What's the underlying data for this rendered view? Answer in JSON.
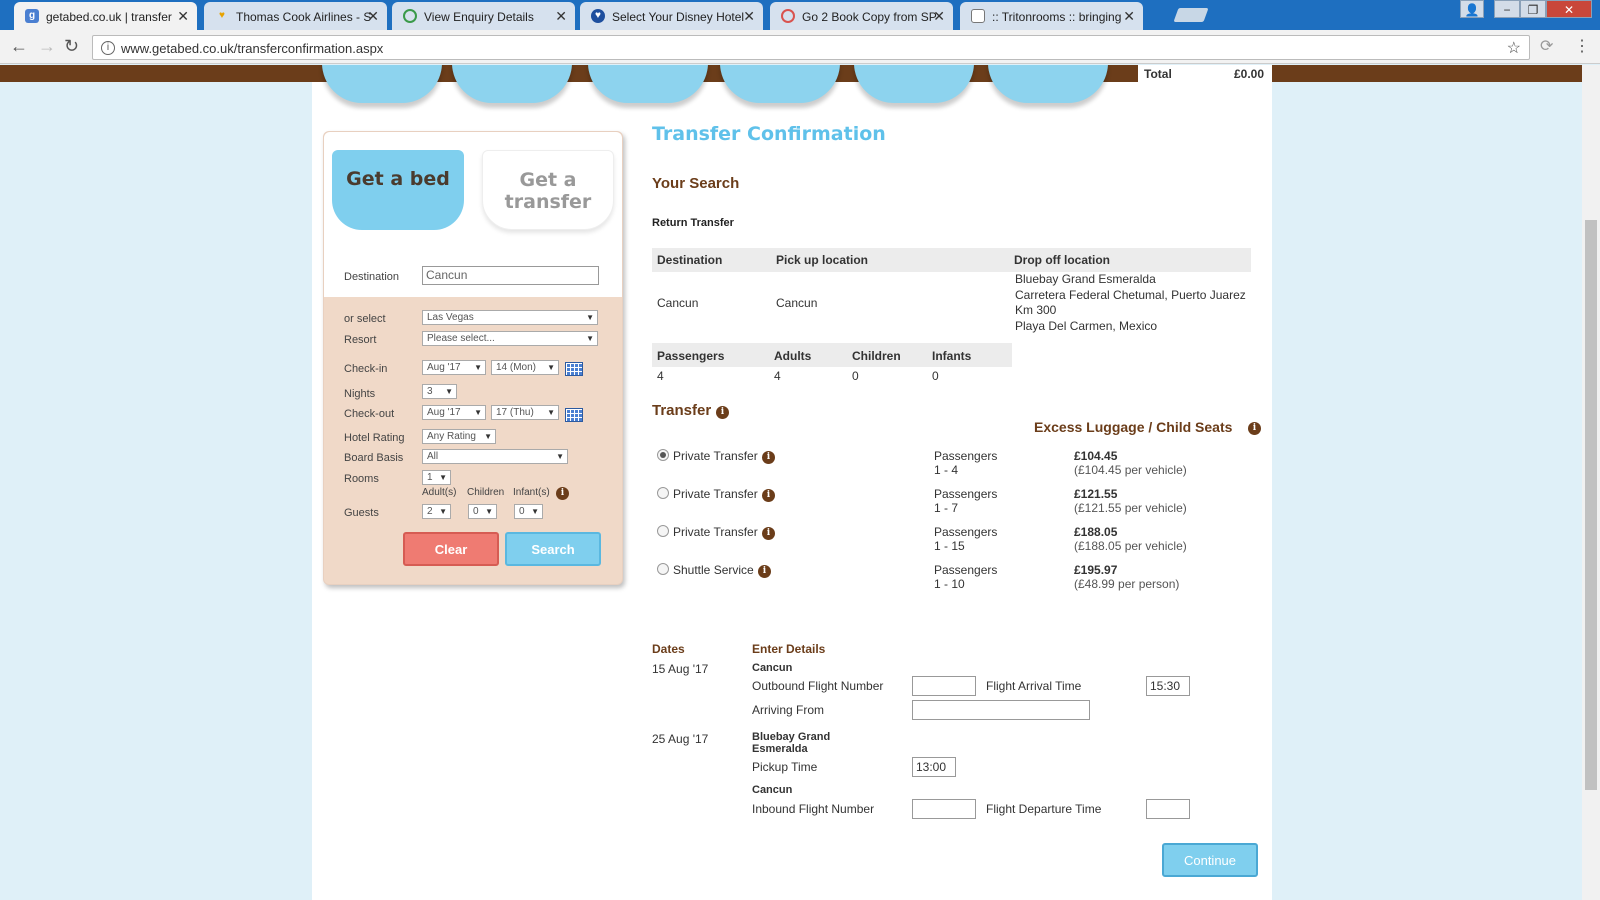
{
  "browser": {
    "tabs": [
      {
        "title": "getabed.co.uk | transfer",
        "favicon": "g"
      },
      {
        "title": "Thomas Cook Airlines - S",
        "favicon": "heart"
      },
      {
        "title": "View Enquiry Details",
        "favicon": "o"
      },
      {
        "title": "Select Your Disney Hotel",
        "favicon": "shield"
      },
      {
        "title": "Go 2 Book Copy from SP",
        "favicon": "o"
      },
      {
        "title": ":: Tritonrooms :: bringing",
        "favicon": "page"
      }
    ],
    "url": "www.getabed.co.uk/transferconfirmation.aspx"
  },
  "header": {
    "total_label": "Total",
    "total_value": "£0.00"
  },
  "search_box": {
    "tab_bed": "Get a bed",
    "tab_transfer": "Get a transfer",
    "destination_label": "Destination",
    "destination_value": "Cancun",
    "or_select_label": "or select",
    "or_select_value": "Las Vegas",
    "resort_label": "Resort",
    "resort_value": "Please select...",
    "checkin_label": "Check-in",
    "checkin_month": "Aug '17",
    "checkin_day": "14 (Mon)",
    "nights_label": "Nights",
    "nights_value": "3",
    "checkout_label": "Check-out",
    "checkout_month": "Aug '17",
    "checkout_day": "17 (Thu)",
    "hotel_rating_label": "Hotel Rating",
    "hotel_rating_value": "Any Rating",
    "board_basis_label": "Board Basis",
    "board_basis_value": "All",
    "rooms_label": "Rooms",
    "rooms_value": "1",
    "guests_label": "Guests",
    "adults_label": "Adult(s)",
    "children_label": "Children",
    "infants_label": "Infant(s)",
    "adults_value": "2",
    "children_value": "0",
    "infants_value": "0",
    "clear_label": "Clear",
    "search_label": "Search"
  },
  "main": {
    "title": "Transfer Confirmation",
    "your_search": "Your Search",
    "return_transfer": "Return Transfer",
    "table1_headers": [
      "Destination",
      "Pick up location",
      "Drop off location"
    ],
    "destination": "Cancun",
    "pickup": "Cancun",
    "dropoff_lines": [
      "Bluebay Grand Esmeralda",
      "Carretera Federal Chetumal, Puerto Juarez",
      "Km 300",
      "Playa Del Carmen, Mexico"
    ],
    "table2_headers": [
      "Passengers",
      "Adults",
      "Children",
      "Infants"
    ],
    "table2_values": [
      "4",
      "4",
      "0",
      "0"
    ],
    "transfer_heading": "Transfer",
    "excess_heading": "Excess Luggage / Child Seats",
    "options": [
      {
        "name": "Private Transfer",
        "pax_label": "Passengers",
        "pax_range": "1 - 4",
        "price": "£104.45",
        "unit": "(£104.45 per vehicle)",
        "selected": true
      },
      {
        "name": "Private Transfer",
        "pax_label": "Passengers",
        "pax_range": "1 - 7",
        "price": "£121.55",
        "unit": "(£121.55 per vehicle)",
        "selected": false
      },
      {
        "name": "Private Transfer",
        "pax_label": "Passengers",
        "pax_range": "1 - 15",
        "price": "£188.05",
        "unit": "(£188.05 per vehicle)",
        "selected": false
      },
      {
        "name": "Shuttle Service",
        "pax_label": "Passengers",
        "pax_range": "1 - 10",
        "price": "£195.97",
        "unit": "(£48.99 per person)",
        "selected": false
      }
    ],
    "dates_heading": "Dates",
    "details_heading": "Enter Details",
    "date1": "15 Aug '17",
    "location1": "Cancun",
    "outbound_label": "Outbound Flight Number",
    "outbound_value": "",
    "arrival_time_label": "Flight Arrival Time",
    "arrival_time_value": "15:30",
    "arriving_from_label": "Arriving From",
    "arriving_from_value": "",
    "date2": "25 Aug '17",
    "location2_line1": "Bluebay Grand",
    "location2_line2": "Esmeralda",
    "pickup_time_label": "Pickup Time",
    "pickup_time_value": "13:00",
    "location3": "Cancun",
    "inbound_label": "Inbound Flight Number",
    "inbound_value": "",
    "departure_time_label": "Flight Departure Time",
    "departure_time_value": "",
    "continue_label": "Continue"
  }
}
